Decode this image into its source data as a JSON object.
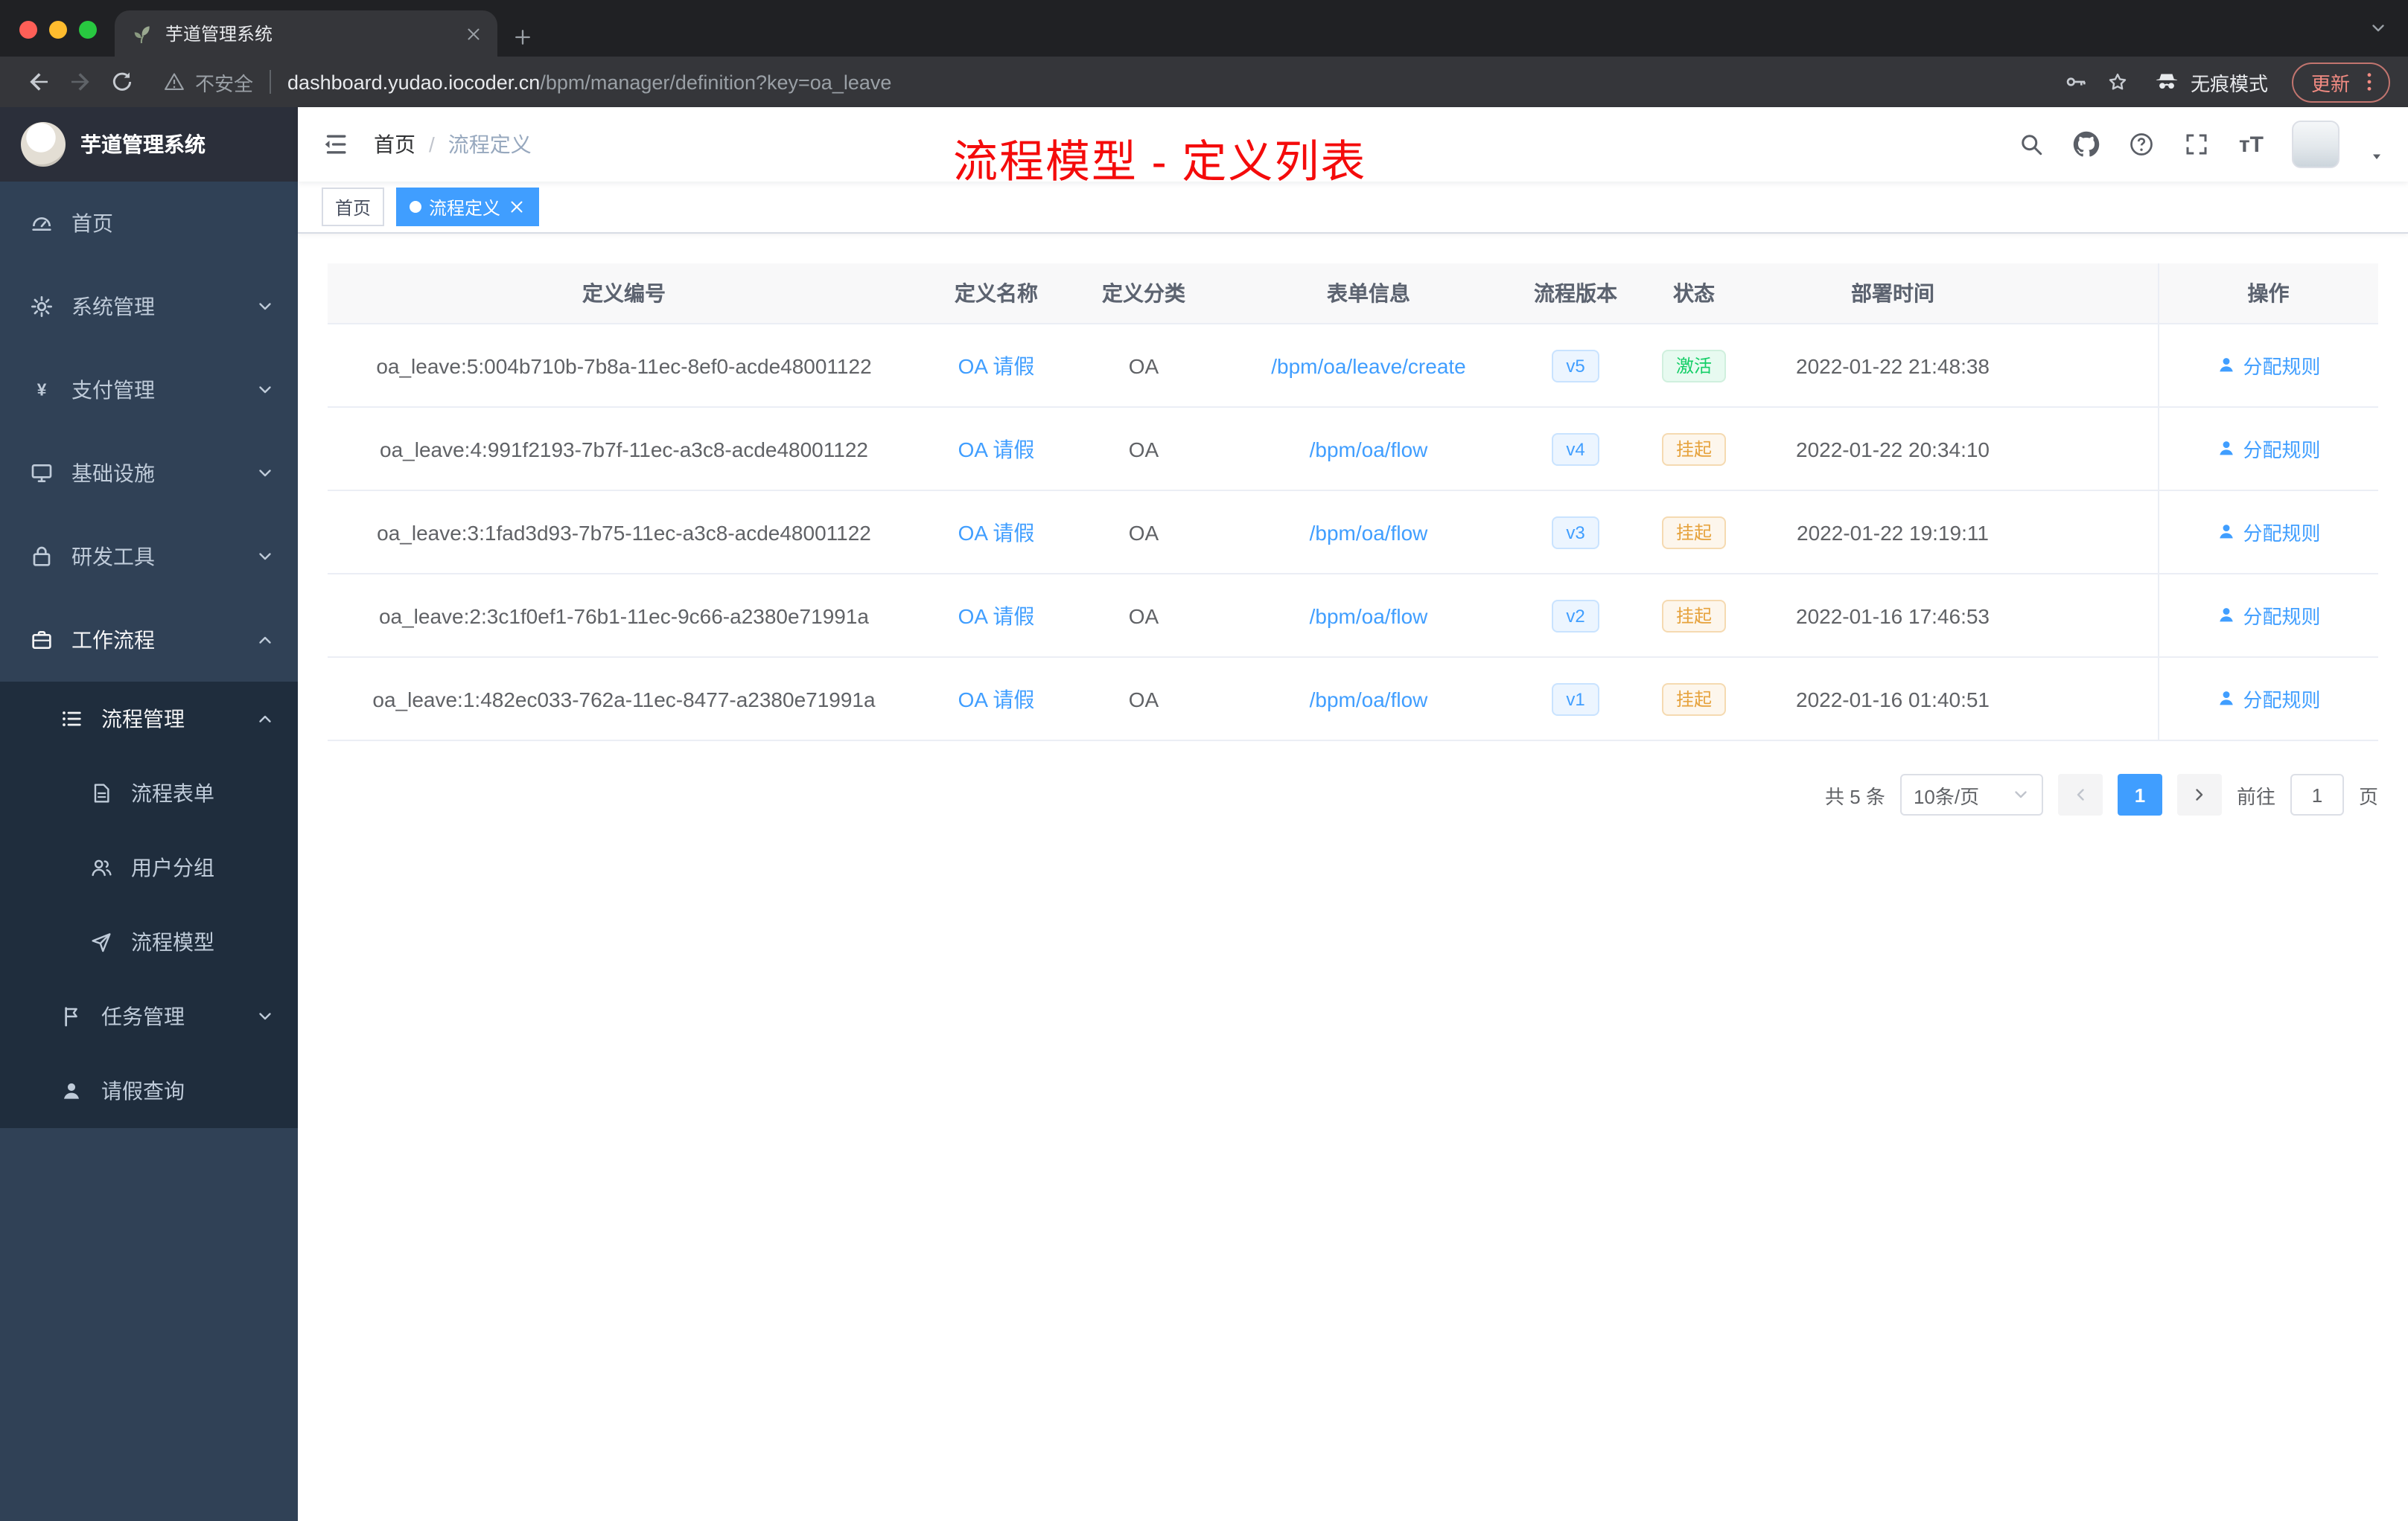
{
  "colors": {
    "accent": "#409eff",
    "success": "#13ce66",
    "warning": "#e6a23c",
    "annotation_red": "#f40b0b",
    "sidebar_bg": "#304156",
    "sidebar_sub_bg": "#1f2d3d"
  },
  "browser": {
    "tab": {
      "title": "芋道管理系统"
    },
    "address": {
      "security_label": "不安全",
      "domain": "dashboard.yudao.iocoder.cn",
      "path": "/bpm/manager/definition?key=oa_leave"
    },
    "incognito_label": "无痕模式",
    "update_label": "更新"
  },
  "sidebar": {
    "app_title": "芋道管理系统",
    "menu": [
      {
        "label": "首页",
        "icon": "dashboard-icon",
        "level": 1
      },
      {
        "label": "系统管理",
        "icon": "gear-icon",
        "level": 1,
        "chevron": "down"
      },
      {
        "label": "支付管理",
        "icon": "yen-icon",
        "level": 1,
        "chevron": "down"
      },
      {
        "label": "基础设施",
        "icon": "monitor-icon",
        "level": 1,
        "chevron": "down"
      },
      {
        "label": "研发工具",
        "icon": "lock-icon",
        "level": 1,
        "chevron": "down"
      },
      {
        "label": "工作流程",
        "icon": "briefcase-icon",
        "level": 1,
        "chevron": "up",
        "open": true
      },
      {
        "label": "流程管理",
        "icon": "list-icon",
        "level": 2,
        "chevron": "up",
        "open": true
      },
      {
        "label": "流程表单",
        "icon": "document-icon",
        "level": 3
      },
      {
        "label": "用户分组",
        "icon": "users-icon",
        "level": 3
      },
      {
        "label": "流程模型",
        "icon": "send-icon",
        "level": 3
      },
      {
        "label": "任务管理",
        "icon": "flag-icon",
        "level": 2,
        "chevron": "down"
      },
      {
        "label": "请假查询",
        "icon": "user-icon",
        "level": 2
      }
    ]
  },
  "header": {
    "breadcrumb": [
      "首页",
      "流程定义"
    ],
    "annotation": "流程模型 - 定义列表"
  },
  "tags": [
    {
      "label": "首页",
      "active": false
    },
    {
      "label": "流程定义",
      "active": true
    }
  ],
  "table": {
    "columns": [
      "定义编号",
      "定义名称",
      "定义分类",
      "表单信息",
      "流程版本",
      "状态",
      "部署时间",
      "操作"
    ],
    "rows": [
      {
        "id": "oa_leave:5:004b710b-7b8a-11ec-8ef0-acde48001122",
        "name": "OA 请假",
        "category": "OA",
        "form": "/bpm/oa/leave/create",
        "version": "v5",
        "status": "激活",
        "status_type": "active",
        "deploy_time": "2022-01-22 21:48:38",
        "action": "分配规则"
      },
      {
        "id": "oa_leave:4:991f2193-7b7f-11ec-a3c8-acde48001122",
        "name": "OA 请假",
        "category": "OA",
        "form": "/bpm/oa/flow",
        "version": "v4",
        "status": "挂起",
        "status_type": "suspended",
        "deploy_time": "2022-01-22 20:34:10",
        "action": "分配规则"
      },
      {
        "id": "oa_leave:3:1fad3d93-7b75-11ec-a3c8-acde48001122",
        "name": "OA 请假",
        "category": "OA",
        "form": "/bpm/oa/flow",
        "version": "v3",
        "status": "挂起",
        "status_type": "suspended",
        "deploy_time": "2022-01-22 19:19:11",
        "action": "分配规则"
      },
      {
        "id": "oa_leave:2:3c1f0ef1-76b1-11ec-9c66-a2380e71991a",
        "name": "OA 请假",
        "category": "OA",
        "form": "/bpm/oa/flow",
        "version": "v2",
        "status": "挂起",
        "status_type": "suspended",
        "deploy_time": "2022-01-16 17:46:53",
        "action": "分配规则"
      },
      {
        "id": "oa_leave:1:482ec033-762a-11ec-8477-a2380e71991a",
        "name": "OA 请假",
        "category": "OA",
        "form": "/bpm/oa/flow",
        "version": "v1",
        "status": "挂起",
        "status_type": "suspended",
        "deploy_time": "2022-01-16 01:40:51",
        "action": "分配规则"
      }
    ]
  },
  "pagination": {
    "total": "共 5 条",
    "page_size": "10条/页",
    "current_page": "1",
    "goto_label": "前往",
    "goto_value": "1",
    "page_unit": "页"
  }
}
